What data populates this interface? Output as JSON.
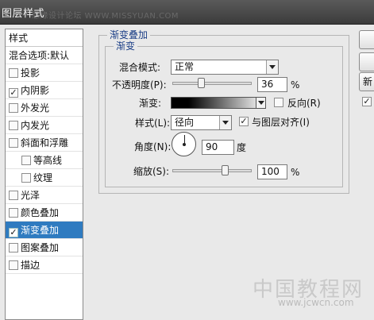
{
  "window": {
    "title": "图层样式",
    "watermark_top": "思缘设计论坛 WWW.MISSYUAN.COM"
  },
  "sidebar": {
    "header": "样式",
    "items": [
      {
        "label": "混合选项:默认",
        "checkbox": false,
        "checked": false,
        "indent": false,
        "selected": false
      },
      {
        "label": "投影",
        "checkbox": true,
        "checked": false,
        "indent": false,
        "selected": false
      },
      {
        "label": "内阴影",
        "checkbox": true,
        "checked": true,
        "indent": false,
        "selected": false
      },
      {
        "label": "外发光",
        "checkbox": true,
        "checked": false,
        "indent": false,
        "selected": false
      },
      {
        "label": "内发光",
        "checkbox": true,
        "checked": false,
        "indent": false,
        "selected": false
      },
      {
        "label": "斜面和浮雕",
        "checkbox": true,
        "checked": false,
        "indent": false,
        "selected": false
      },
      {
        "label": "等高线",
        "checkbox": true,
        "checked": false,
        "indent": true,
        "selected": false
      },
      {
        "label": "纹理",
        "checkbox": true,
        "checked": false,
        "indent": true,
        "selected": false
      },
      {
        "label": "光泽",
        "checkbox": true,
        "checked": false,
        "indent": false,
        "selected": false
      },
      {
        "label": "颜色叠加",
        "checkbox": true,
        "checked": false,
        "indent": false,
        "selected": false
      },
      {
        "label": "渐变叠加",
        "checkbox": true,
        "checked": true,
        "indent": false,
        "selected": true
      },
      {
        "label": "图案叠加",
        "checkbox": true,
        "checked": false,
        "indent": false,
        "selected": false
      },
      {
        "label": "描边",
        "checkbox": true,
        "checked": false,
        "indent": false,
        "selected": false
      }
    ]
  },
  "panel": {
    "outer_legend": "渐变叠加",
    "inner_legend": "渐变",
    "blend_mode": {
      "label": "混合模式:",
      "value": "正常"
    },
    "opacity": {
      "label": "不透明度(P):",
      "value": "36",
      "unit": "%",
      "level": 0.36
    },
    "gradient": {
      "label": "渐变:",
      "reverse_label": "反向(R)",
      "reverse_checked": false
    },
    "style": {
      "label": "样式(L):",
      "value": "径向",
      "align_label": "与图层对齐(I)",
      "align_checked": true
    },
    "angle": {
      "label": "角度(N):",
      "value": "90",
      "unit": "度"
    },
    "scale": {
      "label": "缩放(S):",
      "value": "100",
      "unit": "%",
      "level": 0.66
    }
  },
  "right_buttons": {
    "new_style_label": "新",
    "check_mark": "✓"
  },
  "watermark_bottom": {
    "brand": "中国教程网",
    "url": "www.jcwcn.com"
  }
}
